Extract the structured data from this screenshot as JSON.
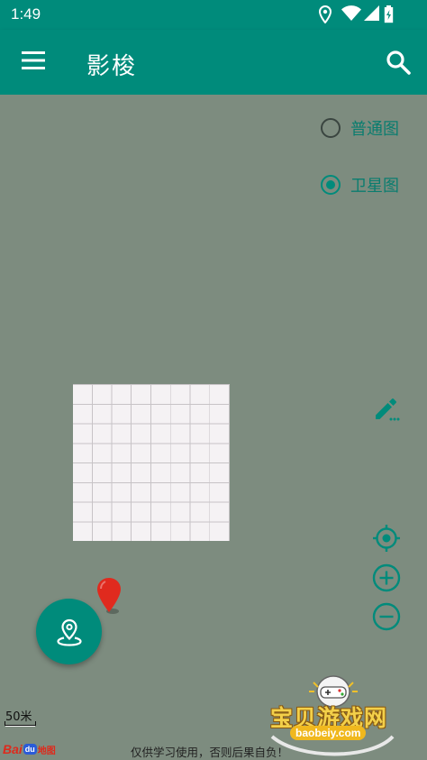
{
  "status_bar": {
    "time": "1:49",
    "icons": [
      "location-icon",
      "wifi-icon",
      "signal-icon",
      "battery-charging-icon"
    ]
  },
  "app_bar": {
    "title": "影梭",
    "menu_icon": "menu-icon",
    "search_icon": "search-icon",
    "color": "#008b7b"
  },
  "map_type": {
    "options": [
      {
        "label": "普通图",
        "selected": false
      },
      {
        "label": "卫星图",
        "selected": true
      }
    ]
  },
  "map_controls": {
    "edit_icon": "pencil-icon",
    "locate_icon": "crosshair-icon",
    "zoom_in_icon": "zoom-in-icon",
    "zoom_out_icon": "zoom-out-icon"
  },
  "fab": {
    "icon": "location-pin-icon"
  },
  "map_footer": {
    "scale_label": "50米",
    "logo_text_bai": "Bai",
    "logo_text_du": "du",
    "logo_text_map": "地图",
    "disclaimer": "仅供学习使用，否则后果自负！"
  },
  "watermark": {
    "title": "宝贝游戏网",
    "domain": "baobeiy.com"
  },
  "colors": {
    "primary": "#008b7b",
    "map_background": "#7d8c7f",
    "marker": "#e02a1e"
  }
}
